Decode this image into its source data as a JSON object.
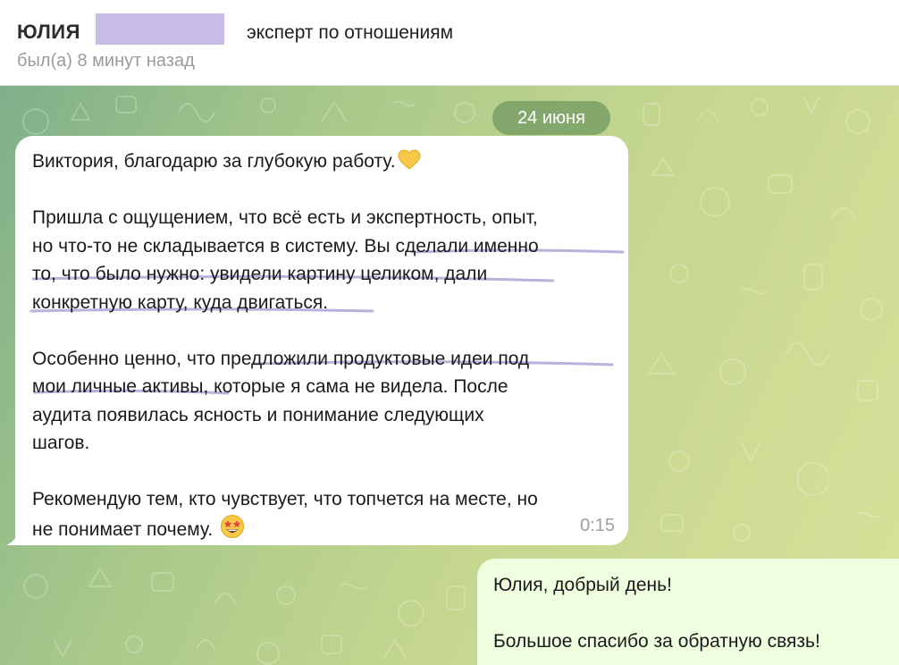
{
  "header": {
    "contact_name": "ЮЛИЯ",
    "subtitle": "эксперт по отношениям",
    "last_seen": "был(а) 8 минут назад"
  },
  "chat": {
    "date_badge": "24 июня",
    "incoming": {
      "lines": {
        "l1": "Виктория, благодарю за глубокую  работу.",
        "l3": "Пришла с ощущением, что всё есть и экспертность, опыт,",
        "l4": "но что-то не складывается в систему. Вы сделали именно",
        "l5": "то, что было нужно: увидели картину целиком, дали",
        "l6": "конкретную карту, куда двигаться.",
        "l8": "Особенно ценно, что предложили продуктовые идеи под",
        "l9": "мои личные активы, которые я сама не видела. После",
        "l10": "аудита появилась ясность и понимание следующих",
        "l11": "шагов.",
        "l13": "Рекомендую тем, кто чувствует, что топчется на месте, но",
        "l14": "не понимает почему."
      },
      "emoji_1": "yellow-heart",
      "emoji_2": "star-struck",
      "time": "0:15"
    },
    "outgoing": {
      "line1": "Юлия, добрый день!",
      "line3": "Большое спасибо за обратную связь!"
    }
  },
  "colors": {
    "underline": "#b9b2dc",
    "redaction": "#c7bde6",
    "outgoing_bubble": "#eefedf",
    "date_badge": "#6e965f"
  }
}
